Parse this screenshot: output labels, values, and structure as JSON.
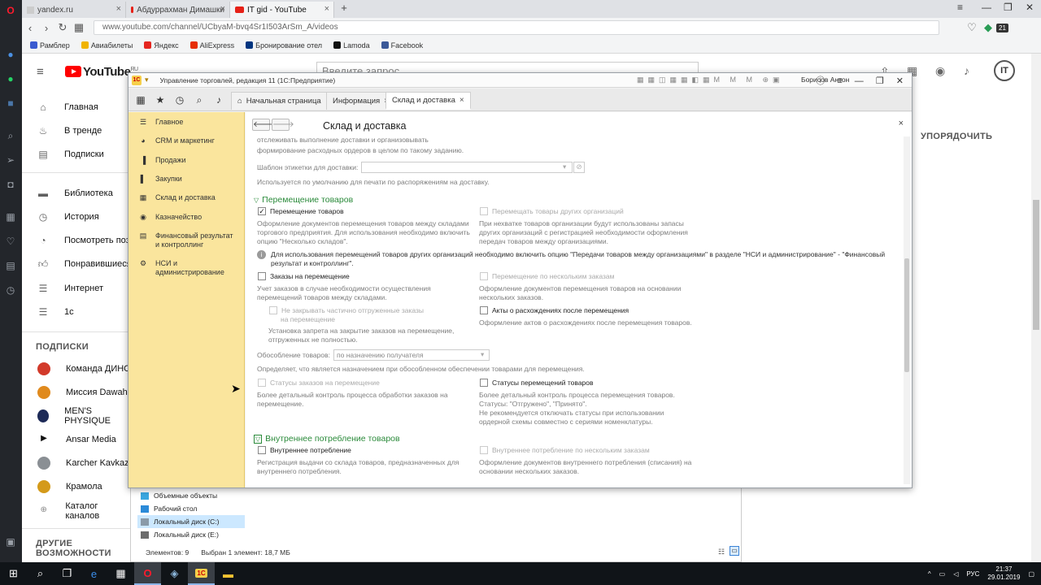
{
  "browser": {
    "tabs": [
      {
        "label": "yandex.ru"
      },
      {
        "label": "Абдуррахман Димашки"
      },
      {
        "label": "IT gid - YouTube"
      }
    ],
    "new_tab": "+",
    "url": "www.youtube.com/channel/UCbyaM-bvq4Sr1I503ArSm_A/videos",
    "bookmarks": [
      {
        "label": "Рамблер",
        "color": "#3a5bd0"
      },
      {
        "label": "Авиабилеты",
        "color": "#f0b400"
      },
      {
        "label": "Яндекс",
        "color": "#e52620"
      },
      {
        "label": "AliExpress",
        "color": "#e62e04"
      },
      {
        "label": "Бронирование отел",
        "color": "#003580"
      },
      {
        "label": "Lamoda",
        "color": "#111111"
      },
      {
        "label": "Facebook",
        "color": "#3b5998"
      }
    ],
    "badge": "21"
  },
  "youtube": {
    "logo": "YouTube",
    "logo_sup": "RU",
    "search_placeholder": "Введите запрос",
    "avatar": "IT",
    "sort_label": "УПОРЯДОЧИТЬ",
    "nav": [
      "Главная",
      "В тренде",
      "Подписки"
    ],
    "library": [
      "Библиотека",
      "История",
      "Посмотреть поз",
      "Понравившиеся",
      "Интернет",
      "1с"
    ],
    "subs_heading": "ПОДПИСКИ",
    "subs": [
      "Команда ДИНО",
      "Миссия Dawah",
      "MEN'S PHYSIQUE",
      "Ansar Media",
      "Karcher Kavkaz",
      "Крамола",
      "Каталог каналов"
    ],
    "more_heading": "ДРУГИЕ ВОЗМОЖНОСТИ"
  },
  "explorer": {
    "items": [
      "Объемные объекты",
      "Рабочий стол",
      "Локальный диск (C:)",
      "Локальный диск (E:)"
    ],
    "status_count": "Элементов: 9",
    "status_selected": "Выбран 1 элемент: 18,7 МБ"
  },
  "onec": {
    "title": "Управление торговлей, редакция 11  (1С:Предприятие)",
    "logo": "1С",
    "user": "Борисов Антон",
    "tabs": [
      "Начальная страница",
      "Информация",
      "Склад и доставка"
    ],
    "nav": [
      "Главное",
      "CRM и маркетинг",
      "Продажи",
      "Закупки",
      "Склад и доставка",
      "Казначейство",
      "Финансовый результат и контроллинг",
      "НСИ и администрирование"
    ],
    "page_title": "Склад и доставка",
    "top_text_1": "отслеживать выполнение доставки и организовывать",
    "top_text_2": "формирование расходных ордеров в целом по такому заданию.",
    "label_template_label": "Шаблон этикетки для доставки:",
    "label_template_note": "Используется по умолчанию для печати по распоряжениям на доставку.",
    "sec_move": "Перемещение товаров",
    "cb_move": "Перемещение товаров",
    "cb_move_note": [
      "Оформление документов перемещения товаров между складами",
      "торгового предприятия. Для использования необходимо включить",
      "опцию \"Несколько складов\"."
    ],
    "cb_move_other": "Перемещать товары других организаций",
    "cb_move_other_note": [
      "При нехватке товаров организации будут использованы запасы",
      "других организаций с регистрацией необходимости оформления",
      "передач товаров между организациями."
    ],
    "info_note": [
      "Для использования перемещений товаров других организаций необходимо включить опцию \"Передачи товаров между организациями\" в разделе \"НСИ и администрирование\" - \"Финансовый",
      "результат и контроллинг\"."
    ],
    "cb_orders": "Заказы на перемещение",
    "cb_orders_note": [
      "Учет заказов в случае необходимости осуществления",
      "перемещений товаров между складами."
    ],
    "cb_multi_orders": "Перемещение по нескольким заказам",
    "cb_multi_orders_note": [
      "Оформление документов перемещения товаров на основании",
      "нескольких заказов."
    ],
    "cb_no_close": [
      "Не закрывать частично отгруженные заказы",
      "на перемещение"
    ],
    "cb_no_close_note": [
      "Установка запрета на закрытие заказов на перемещение,",
      "отгруженных не полностью."
    ],
    "cb_acts": "Акты о расхождениях после перемещения",
    "cb_acts_note": "Оформление актов о расхождениях после перемещения товаров.",
    "isolation_label": "Обособление товаров:",
    "isolation_value": "по назначению получателя",
    "isolation_note": "Определяет, что является назначением при обособленном обеспечении товарами для перемещения.",
    "cb_order_status": "Статусы заказов на перемещение",
    "cb_order_status_note": [
      "Более детальный контроль процесса обработки заказов на",
      "перемещение."
    ],
    "cb_move_status": "Статусы перемещений товаров",
    "cb_move_status_note": [
      "Более детальный контроль процесса перемещения товаров.",
      "Статусы: \"Отгружено\", \"Принято\".",
      "Не рекомендуется отключать статусы при использовании",
      "ордерной схемы совместно с сериями номенклатуры."
    ],
    "sec_consume": "Внутреннее потребление товаров",
    "cb_consume": "Внутреннее потребление",
    "cb_consume_note": [
      "Регистрация выдачи со склада товаров, предназначенных для",
      "внутреннего потребления."
    ],
    "cb_consume_multi": "Внутреннее потребление по нескольким заказам",
    "cb_consume_multi_note": [
      "Оформление документов внутреннего потребления (списания) на",
      "основании нескольких заказов."
    ]
  },
  "taskbar": {
    "lang": "РУС",
    "time": "21:37",
    "date": "29.01.2019"
  }
}
